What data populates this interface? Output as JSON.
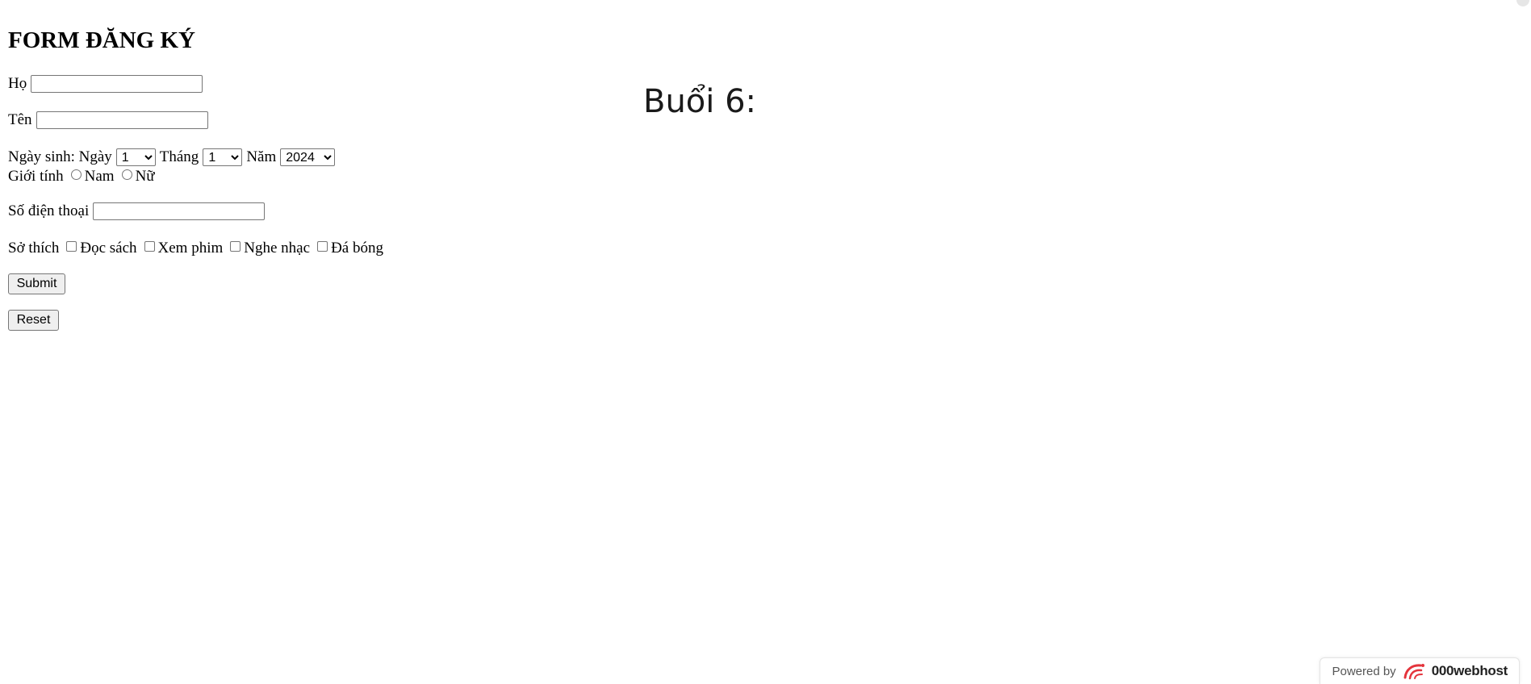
{
  "form": {
    "title": "FORM ĐĂNG KÝ",
    "ho_label": "Họ",
    "ho_value": "",
    "ten_label": "Tên",
    "ten_value": "",
    "dob_label": "Ngày sinh:",
    "day_label": "Ngày",
    "day_value": "1",
    "month_label": "Tháng",
    "month_value": "1",
    "year_label": "Năm",
    "year_value": "2024",
    "gender_label": "Giới tính",
    "gender_options": [
      "Nam",
      "Nữ"
    ],
    "phone_label": "Số điện thoại",
    "phone_value": "",
    "hobbies_label": "Sở thích",
    "hobbies": [
      "Đọc sách",
      "Xem phim",
      "Nghe nhạc",
      "Đá bóng"
    ],
    "submit_label": "Submit",
    "reset_label": "Reset"
  },
  "session_title": "Buổi 6:",
  "footer": {
    "powered_label": "Powered by",
    "brand": "000webhost",
    "brand_color": "#e4343c"
  }
}
